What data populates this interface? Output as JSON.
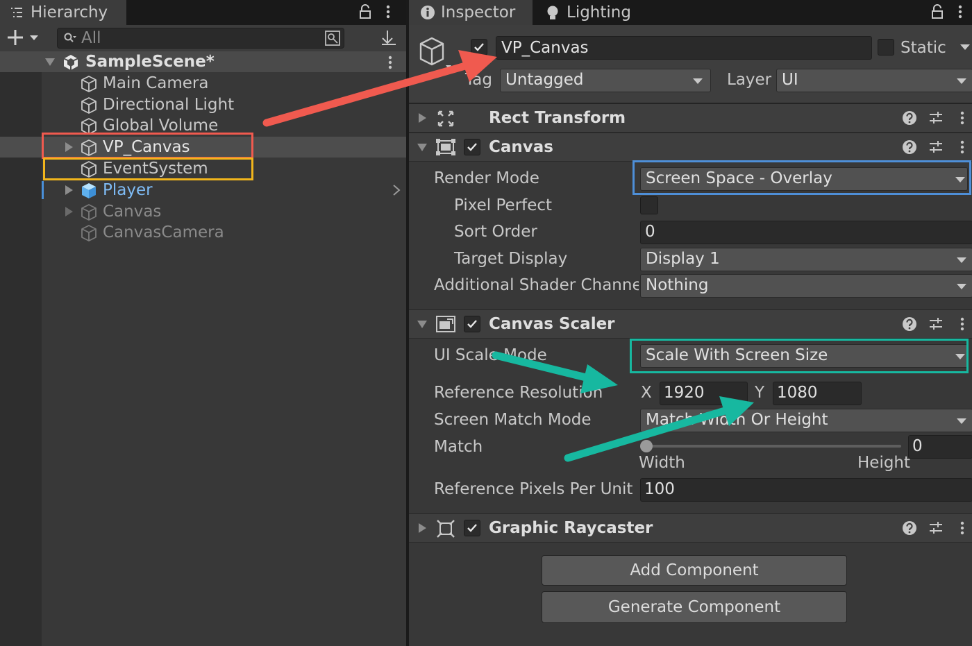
{
  "hierarchy": {
    "tab_label": "Hierarchy",
    "search_placeholder": "All",
    "scene_name": "SampleScene*",
    "items": [
      {
        "label": "Main Camera"
      },
      {
        "label": "Directional Light"
      },
      {
        "label": "Global Volume"
      },
      {
        "label": "VP_Canvas"
      },
      {
        "label": "EventSystem"
      },
      {
        "label": "Player"
      },
      {
        "label": "Canvas"
      },
      {
        "label": "CanvasCamera"
      }
    ]
  },
  "inspector": {
    "tabs": [
      "Inspector",
      "Lighting"
    ],
    "object_name": "VP_Canvas",
    "static_label": "Static",
    "tag_label": "Tag",
    "tag_value": "Untagged",
    "layer_label": "Layer",
    "layer_value": "UI",
    "components": {
      "rect_transform": {
        "title": "Rect Transform"
      },
      "canvas": {
        "title": "Canvas",
        "render_mode_label": "Render Mode",
        "render_mode_value": "Screen Space - Overlay",
        "pixel_perfect_label": "Pixel Perfect",
        "sort_order_label": "Sort Order",
        "sort_order_value": "0",
        "target_display_label": "Target Display",
        "target_display_value": "Display 1",
        "shader_channels_label": "Additional Shader Channels",
        "shader_channels_value": "Nothing"
      },
      "canvas_scaler": {
        "title": "Canvas Scaler",
        "ui_scale_mode_label": "UI Scale Mode",
        "ui_scale_mode_value": "Scale With Screen Size",
        "ref_res_label": "Reference Resolution",
        "x_label": "X",
        "x_value": "1920",
        "y_label": "Y",
        "y_value": "1080",
        "match_mode_label": "Screen Match Mode",
        "match_mode_value": "Match Width Or Height",
        "match_label": "Match",
        "match_value": "0",
        "width_label": "Width",
        "height_label": "Height",
        "ppu_label": "Reference Pixels Per Unit",
        "ppu_value": "100"
      },
      "graphic_raycaster": {
        "title": "Graphic Raycaster"
      }
    },
    "add_component": "Add Component",
    "generate_component": "Generate Component"
  },
  "colors": {
    "annotation_red": "#f05a4f",
    "annotation_orange": "#f1b51c",
    "annotation_blue": "#4e8fd8",
    "annotation_teal": "#17b8a0",
    "player_blue": "#7fbcf6"
  }
}
